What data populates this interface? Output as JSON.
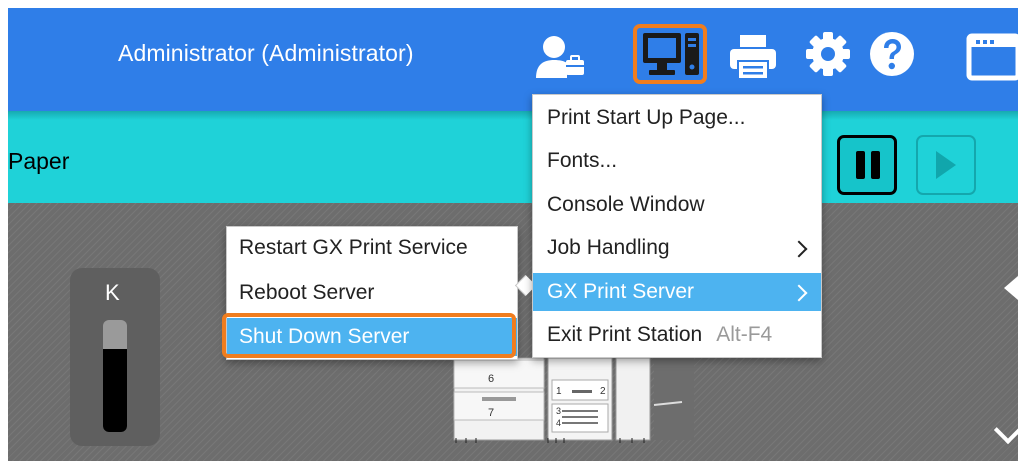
{
  "header": {
    "user_label": "Administrator (Administrator)",
    "icons": [
      "user-icon",
      "monitor-icon",
      "printer-icon",
      "gear-icon",
      "help-icon",
      "window-icon"
    ],
    "accent_color": "#2f7ee8",
    "highlight_color": "#f07d1e"
  },
  "toolbar": {
    "title": "Paper",
    "bar_color": "#1fd2d8",
    "pause_icon": "pause-icon",
    "play_icon": "play-icon"
  },
  "toner": {
    "label": "K",
    "level": 0.74
  },
  "main_menu": {
    "items": [
      {
        "label": "Print Start Up Page..."
      },
      {
        "label": "Fonts..."
      },
      {
        "label": "Console Window"
      },
      {
        "label": "Job Handling"
      },
      {
        "label": "GX Print Server"
      },
      {
        "label": "Exit Print Station",
        "shortcut": "Alt-F4"
      }
    ]
  },
  "sub_menu": {
    "items": [
      {
        "label": "Restart GX Print Service"
      },
      {
        "label": "Reboot Server"
      },
      {
        "label": "Shut Down Server"
      }
    ]
  },
  "printer_trays": [
    "6",
    "7",
    "1",
    "2",
    "3",
    "4"
  ]
}
